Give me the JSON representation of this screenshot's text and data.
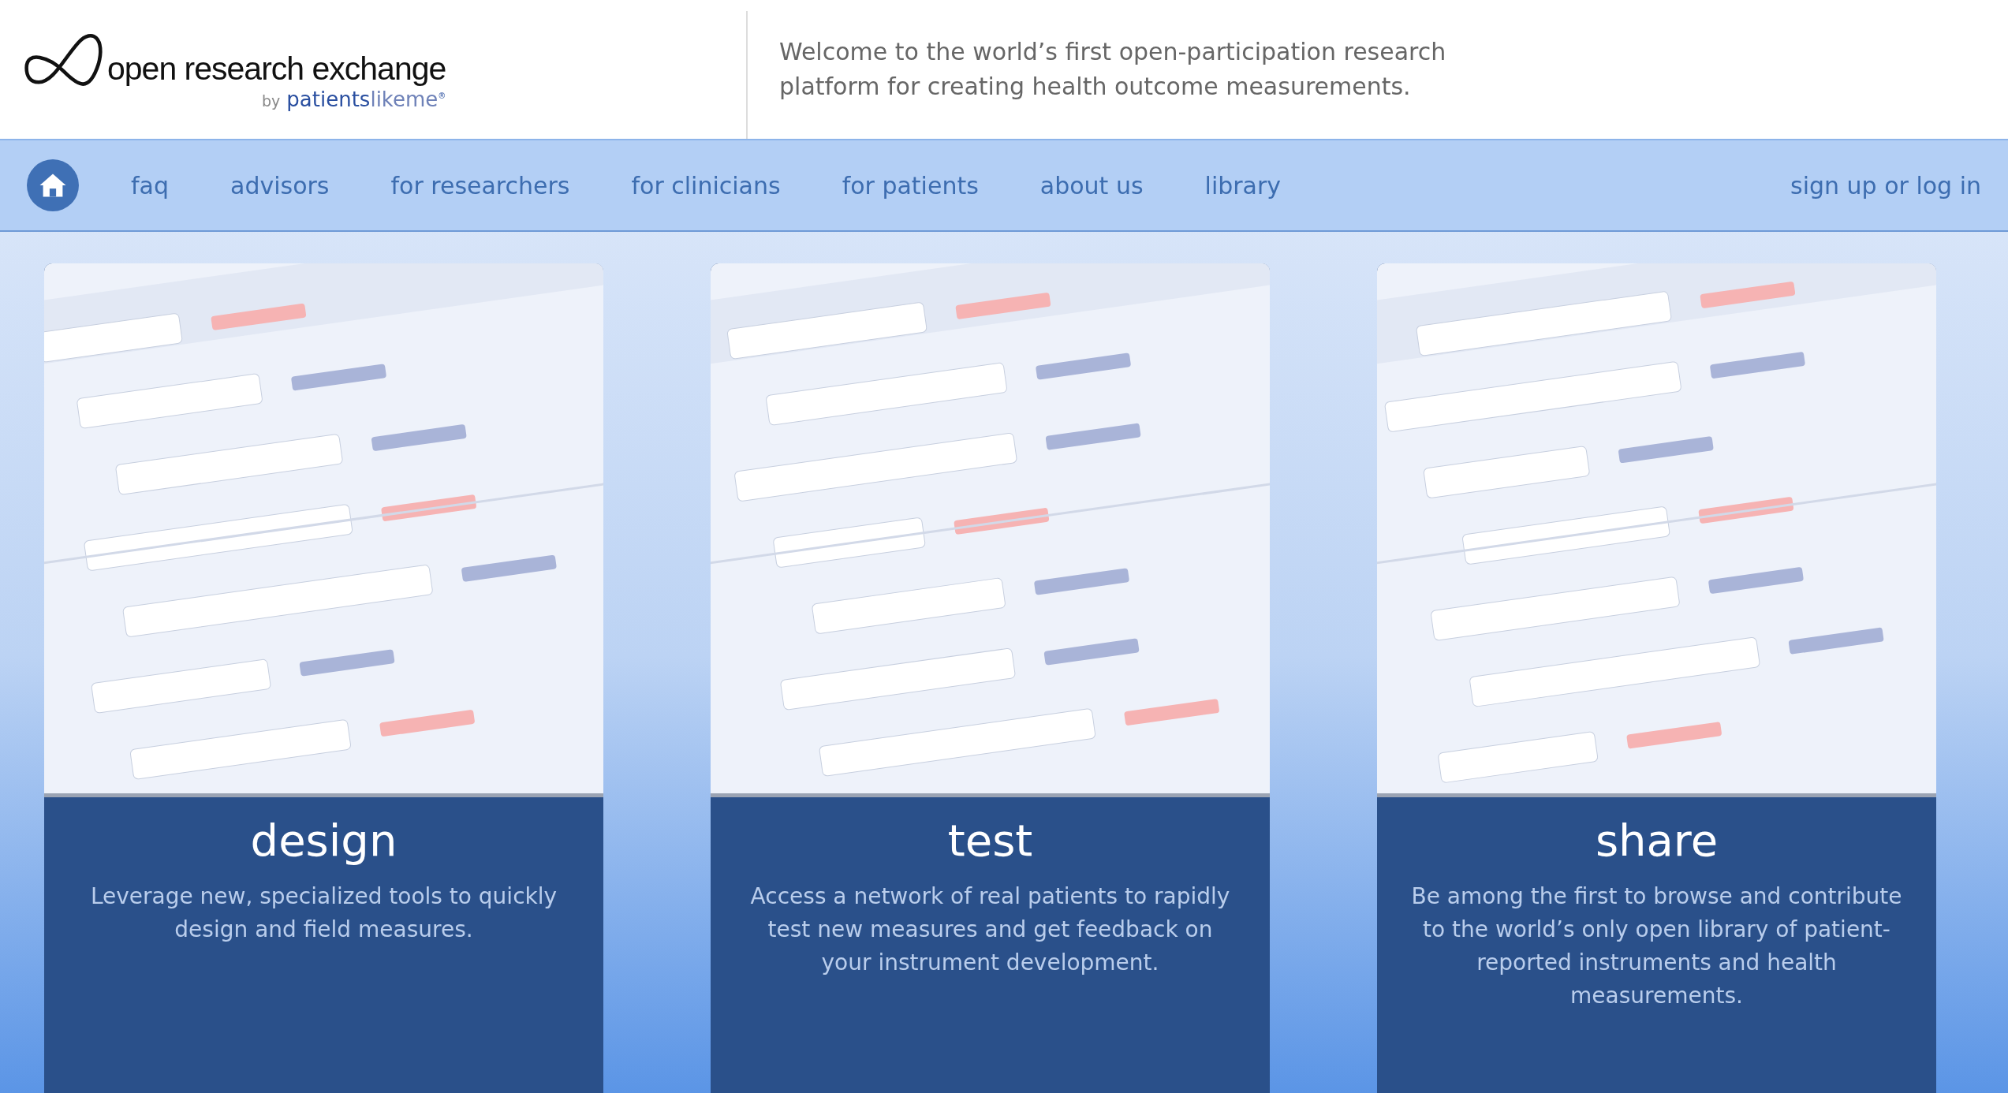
{
  "logo": {
    "name": "open research exchange",
    "by": "by",
    "brand_main": "patients",
    "brand_tail": "likeme",
    "mark": "®"
  },
  "tagline": "Welcome to the world’s first open-participation research platform for creating health outcome measurements.",
  "nav": {
    "items": [
      "faq",
      "advisors",
      "for researchers",
      "for clinicians",
      "for patients",
      "about us",
      "library"
    ],
    "account": "sign up or log in"
  },
  "cards": [
    {
      "title": "design",
      "text": "Leverage new, specialized tools to quickly design and field measures."
    },
    {
      "title": "test",
      "text": "Access a network of real patients to rapidly test new measures and get feedback on your instrument development."
    },
    {
      "title": "share",
      "text": "Be among the first to browse and contribute to the world’s only open library of patient-reported instruments and health measurements."
    }
  ]
}
